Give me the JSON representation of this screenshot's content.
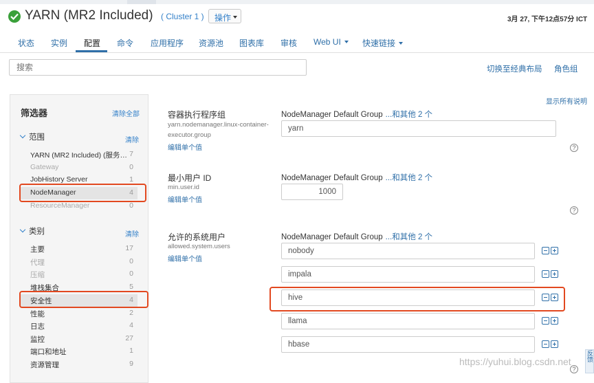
{
  "header": {
    "service_title": "YARN (MR2 Included)",
    "cluster_link": "( Cluster 1 )",
    "ops_button": "操作",
    "timestamp": "3月 27, 下午12点57分 ICT"
  },
  "tabs": [
    {
      "label": "状态"
    },
    {
      "label": "实例"
    },
    {
      "label": "配置",
      "active": true
    },
    {
      "label": "命令"
    },
    {
      "label": "应用程序"
    },
    {
      "label": "资源池"
    },
    {
      "label": "图表库"
    },
    {
      "label": "审核"
    },
    {
      "label": "Web UI",
      "dropdown": true
    },
    {
      "label": "快速链接",
      "dropdown": true
    }
  ],
  "search": {
    "placeholder": "搜索"
  },
  "toolbar": {
    "switch_classic": "切换至经典布局",
    "role_groups": "角色组"
  },
  "filter": {
    "title": "筛选器",
    "clear_all": "清除全部",
    "scope": {
      "heading": "范围",
      "clear": "清除",
      "items": [
        {
          "label": "YARN (MR2 Included) (服务…",
          "count": "7"
        },
        {
          "label": "Gateway",
          "count": "0"
        },
        {
          "label": "JobHistory Server",
          "count": "1"
        },
        {
          "label": "NodeManager",
          "count": "4"
        },
        {
          "label": "ResourceManager",
          "count": "0"
        }
      ]
    },
    "category": {
      "heading": "类别",
      "clear": "清除",
      "items": [
        {
          "label": "主要",
          "count": "17"
        },
        {
          "label": "代理",
          "count": "0"
        },
        {
          "label": "压缩",
          "count": "0"
        },
        {
          "label": "堆栈集合",
          "count": "5"
        },
        {
          "label": "安全性",
          "count": "4"
        },
        {
          "label": "性能",
          "count": "2"
        },
        {
          "label": "日志",
          "count": "4"
        },
        {
          "label": "监控",
          "count": "27"
        },
        {
          "label": "端口和地址",
          "count": "1"
        },
        {
          "label": "资源管理",
          "count": "9"
        }
      ]
    }
  },
  "main": {
    "show_all_desc": "显示所有说明",
    "configs": [
      {
        "name": "容器执行程序组",
        "key": "yarn.nodemanager.linux-container-executor.group",
        "edit": "编辑单个值",
        "group": "NodeManager Default Group",
        "more": "...和其他 2 个",
        "values": [
          "yarn"
        ]
      },
      {
        "name": "最小用户 ID",
        "key": "min.user.id",
        "edit": "编辑单个值",
        "group": "NodeManager Default Group",
        "more": "...和其他 2 个",
        "values": [
          "1000"
        ]
      },
      {
        "name": "允许的系统用户",
        "key": "allowed.system.users",
        "edit": "编辑单个值",
        "group": "NodeManager Default Group",
        "more": "...和其他 2 个",
        "values": [
          "nobody",
          "impala",
          "hive",
          "llama",
          "hbase"
        ]
      }
    ]
  },
  "watermark": "https://yuhui.blog.csdn.net",
  "side_tab": "反馈"
}
